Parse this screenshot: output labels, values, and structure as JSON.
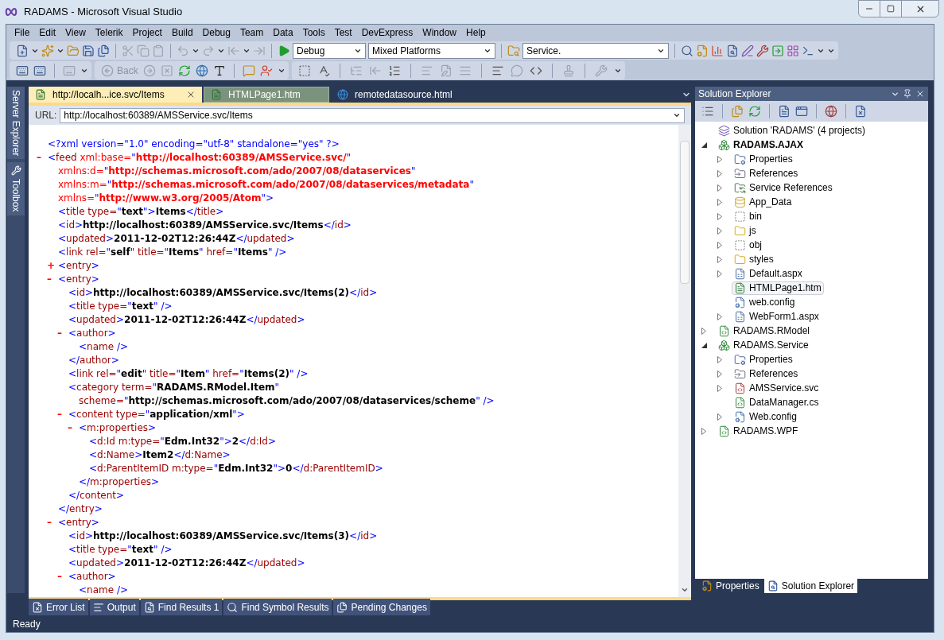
{
  "window": {
    "title": "RADAMS - Microsoft Visual Studio"
  },
  "menu": [
    "File",
    "Edit",
    "View",
    "Telerik",
    "Project",
    "Build",
    "Debug",
    "Team",
    "Data",
    "Tools",
    "Test",
    "DevExpress",
    "Window",
    "Help"
  ],
  "toolbar": {
    "configuration": "Debug",
    "platform": "Mixed Platforms",
    "find": "Service.",
    "back_label": "Back"
  },
  "side_tabs": [
    "Server Explorer",
    "Toolbox"
  ],
  "document": {
    "tabs": [
      {
        "label": "http://localh...ice.svc/Items",
        "selected": true,
        "highlighted": false,
        "kind": "page"
      },
      {
        "label": "HTMLPage1.htm",
        "selected": false,
        "highlighted": true,
        "kind": "page"
      },
      {
        "label": "remotedatasource.html",
        "selected": false,
        "highlighted": false,
        "kind": "browser"
      }
    ],
    "url_label": "URL:",
    "url": "http://localhost:60389/AMSService.svc/Items",
    "xml": [
      {
        "segs": [
          {
            "kind": "punct",
            "text": "<?xml version=\"1.0\" encoding=\"utf-8\" standalone=\"yes\" ?>"
          }
        ]
      },
      {
        "toggle": "–",
        "segs": [
          {
            "kind": "punct",
            "text": "<"
          },
          {
            "kind": "name",
            "text": "feed "
          },
          {
            "kind": "attr",
            "text": "xml:base="
          },
          {
            "kind": "punct",
            "text": "\""
          },
          {
            "kind": "url",
            "text": "http://localhost:60389/AMSService.svc/"
          },
          {
            "kind": "punct",
            "text": "\""
          }
        ],
        "cont": [
          [
            {
              "kind": "attr",
              "text": "xmlns:d="
            },
            {
              "kind": "punct",
              "text": "\""
            },
            {
              "kind": "url",
              "text": "http://schemas.microsoft.com/ado/2007/08/dataservices"
            },
            {
              "kind": "punct",
              "text": "\""
            }
          ],
          [
            {
              "kind": "attr",
              "text": "xmlns:m="
            },
            {
              "kind": "punct",
              "text": "\""
            },
            {
              "kind": "url",
              "text": "http://schemas.microsoft.com/ado/2007/08/dataservices/metadata"
            },
            {
              "kind": "punct",
              "text": "\""
            }
          ],
          [
            {
              "kind": "attr",
              "text": "xmlns="
            },
            {
              "kind": "punct",
              "text": "\""
            },
            {
              "kind": "url",
              "text": "http://www.w3.org/2005/Atom"
            },
            {
              "kind": "punct",
              "text": "\">"
            }
          ]
        ],
        "children": [
          {
            "segs": [
              {
                "kind": "punct",
                "text": "<"
              },
              {
                "kind": "name",
                "text": "title type="
              },
              {
                "kind": "punct",
                "text": "\""
              },
              {
                "kind": "value",
                "text": "text"
              },
              {
                "kind": "punct",
                "text": "\">"
              },
              {
                "kind": "value",
                "text": "Items"
              },
              {
                "kind": "punct",
                "text": "</"
              },
              {
                "kind": "name",
                "text": "title"
              },
              {
                "kind": "punct",
                "text": ">"
              }
            ]
          },
          {
            "segs": [
              {
                "kind": "punct",
                "text": "<"
              },
              {
                "kind": "name",
                "text": "id"
              },
              {
                "kind": "punct",
                "text": ">"
              },
              {
                "kind": "value",
                "text": "http://localhost:60389/AMSService.svc/Items"
              },
              {
                "kind": "punct",
                "text": "</"
              },
              {
                "kind": "name",
                "text": "id"
              },
              {
                "kind": "punct",
                "text": ">"
              }
            ]
          },
          {
            "segs": [
              {
                "kind": "punct",
                "text": "<"
              },
              {
                "kind": "name",
                "text": "updated"
              },
              {
                "kind": "punct",
                "text": ">"
              },
              {
                "kind": "value",
                "text": "2011-12-02T12:26:44Z"
              },
              {
                "kind": "punct",
                "text": "</"
              },
              {
                "kind": "name",
                "text": "updated"
              },
              {
                "kind": "punct",
                "text": ">"
              }
            ]
          },
          {
            "segs": [
              {
                "kind": "punct",
                "text": "<"
              },
              {
                "kind": "name",
                "text": "link rel="
              },
              {
                "kind": "punct",
                "text": "\""
              },
              {
                "kind": "value",
                "text": "self"
              },
              {
                "kind": "punct",
                "text": "\" "
              },
              {
                "kind": "name",
                "text": "title="
              },
              {
                "kind": "punct",
                "text": "\""
              },
              {
                "kind": "value",
                "text": "Items"
              },
              {
                "kind": "punct",
                "text": "\" "
              },
              {
                "kind": "name",
                "text": "href="
              },
              {
                "kind": "punct",
                "text": "\""
              },
              {
                "kind": "value",
                "text": "Items"
              },
              {
                "kind": "punct",
                "text": "\" />"
              }
            ]
          },
          {
            "toggle": "+",
            "segs": [
              {
                "kind": "punct",
                "text": "<"
              },
              {
                "kind": "name",
                "text": "entry"
              },
              {
                "kind": "punct",
                "text": ">"
              }
            ]
          },
          {
            "toggle": "–",
            "segs": [
              {
                "kind": "punct",
                "text": "<"
              },
              {
                "kind": "name",
                "text": "entry"
              },
              {
                "kind": "punct",
                "text": ">"
              }
            ],
            "children": [
              {
                "segs": [
                  {
                    "kind": "punct",
                    "text": "<"
                  },
                  {
                    "kind": "name",
                    "text": "id"
                  },
                  {
                    "kind": "punct",
                    "text": ">"
                  },
                  {
                    "kind": "value",
                    "text": "http://localhost:60389/AMSService.svc/Items(2)"
                  },
                  {
                    "kind": "punct",
                    "text": "</"
                  },
                  {
                    "kind": "name",
                    "text": "id"
                  },
                  {
                    "kind": "punct",
                    "text": ">"
                  }
                ]
              },
              {
                "segs": [
                  {
                    "kind": "punct",
                    "text": "<"
                  },
                  {
                    "kind": "name",
                    "text": "title type="
                  },
                  {
                    "kind": "punct",
                    "text": "\""
                  },
                  {
                    "kind": "value",
                    "text": "text"
                  },
                  {
                    "kind": "punct",
                    "text": "\" />"
                  }
                ]
              },
              {
                "segs": [
                  {
                    "kind": "punct",
                    "text": "<"
                  },
                  {
                    "kind": "name",
                    "text": "updated"
                  },
                  {
                    "kind": "punct",
                    "text": ">"
                  },
                  {
                    "kind": "value",
                    "text": "2011-12-02T12:26:44Z"
                  },
                  {
                    "kind": "punct",
                    "text": "</"
                  },
                  {
                    "kind": "name",
                    "text": "updated"
                  },
                  {
                    "kind": "punct",
                    "text": ">"
                  }
                ]
              },
              {
                "toggle": "–",
                "segs": [
                  {
                    "kind": "punct",
                    "text": "<"
                  },
                  {
                    "kind": "name",
                    "text": "author"
                  },
                  {
                    "kind": "punct",
                    "text": ">"
                  }
                ],
                "children": [
                  {
                    "segs": [
                      {
                        "kind": "punct",
                        "text": "<"
                      },
                      {
                        "kind": "name",
                        "text": "name"
                      },
                      {
                        "kind": "punct",
                        "text": " />"
                      }
                    ]
                  }
                ],
                "close": [
                  {
                    "kind": "punct",
                    "text": "</"
                  },
                  {
                    "kind": "name",
                    "text": "author"
                  },
                  {
                    "kind": "punct",
                    "text": ">"
                  }
                ]
              },
              {
                "segs": [
                  {
                    "kind": "punct",
                    "text": "<"
                  },
                  {
                    "kind": "name",
                    "text": "link rel="
                  },
                  {
                    "kind": "punct",
                    "text": "\""
                  },
                  {
                    "kind": "value",
                    "text": "edit"
                  },
                  {
                    "kind": "punct",
                    "text": "\" "
                  },
                  {
                    "kind": "name",
                    "text": "title="
                  },
                  {
                    "kind": "punct",
                    "text": "\""
                  },
                  {
                    "kind": "value",
                    "text": "Item"
                  },
                  {
                    "kind": "punct",
                    "text": "\" "
                  },
                  {
                    "kind": "name",
                    "text": "href="
                  },
                  {
                    "kind": "punct",
                    "text": "\""
                  },
                  {
                    "kind": "value",
                    "text": "Items(2)"
                  },
                  {
                    "kind": "punct",
                    "text": "\" />"
                  }
                ]
              },
              {
                "segs": [
                  {
                    "kind": "punct",
                    "text": "<"
                  },
                  {
                    "kind": "name",
                    "text": "category term="
                  },
                  {
                    "kind": "punct",
                    "text": "\""
                  },
                  {
                    "kind": "value",
                    "text": "RADAMS.RModel.Item"
                  },
                  {
                    "kind": "punct",
                    "text": "\""
                  }
                ],
                "cont": [
                  [
                    {
                      "kind": "name",
                      "text": "scheme="
                    },
                    {
                      "kind": "punct",
                      "text": "\""
                    },
                    {
                      "kind": "value",
                      "text": "http://schemas.microsoft.com/ado/2007/08/dataservices/scheme"
                    },
                    {
                      "kind": "punct",
                      "text": "\" />"
                    }
                  ]
                ]
              },
              {
                "toggle": "–",
                "segs": [
                  {
                    "kind": "punct",
                    "text": "<"
                  },
                  {
                    "kind": "name",
                    "text": "content type="
                  },
                  {
                    "kind": "punct",
                    "text": "\""
                  },
                  {
                    "kind": "value",
                    "text": "application/xml"
                  },
                  {
                    "kind": "punct",
                    "text": "\">"
                  }
                ],
                "children": [
                  {
                    "toggle": "–",
                    "segs": [
                      {
                        "kind": "punct",
                        "text": "<"
                      },
                      {
                        "kind": "name",
                        "text": "m:properties"
                      },
                      {
                        "kind": "punct",
                        "text": ">"
                      }
                    ],
                    "children": [
                      {
                        "segs": [
                          {
                            "kind": "punct",
                            "text": "<"
                          },
                          {
                            "kind": "name",
                            "text": "d:Id m:type="
                          },
                          {
                            "kind": "punct",
                            "text": "\""
                          },
                          {
                            "kind": "value",
                            "text": "Edm.Int32"
                          },
                          {
                            "kind": "punct",
                            "text": "\">"
                          },
                          {
                            "kind": "value",
                            "text": "2"
                          },
                          {
                            "kind": "punct",
                            "text": "</"
                          },
                          {
                            "kind": "name",
                            "text": "d:Id"
                          },
                          {
                            "kind": "punct",
                            "text": ">"
                          }
                        ]
                      },
                      {
                        "segs": [
                          {
                            "kind": "punct",
                            "text": "<"
                          },
                          {
                            "kind": "name",
                            "text": "d:Name"
                          },
                          {
                            "kind": "punct",
                            "text": ">"
                          },
                          {
                            "kind": "value",
                            "text": "Item2"
                          },
                          {
                            "kind": "punct",
                            "text": "</"
                          },
                          {
                            "kind": "name",
                            "text": "d:Name"
                          },
                          {
                            "kind": "punct",
                            "text": ">"
                          }
                        ]
                      },
                      {
                        "segs": [
                          {
                            "kind": "punct",
                            "text": "<"
                          },
                          {
                            "kind": "name",
                            "text": "d:ParentItemID m:type="
                          },
                          {
                            "kind": "punct",
                            "text": "\""
                          },
                          {
                            "kind": "value",
                            "text": "Edm.Int32"
                          },
                          {
                            "kind": "punct",
                            "text": "\">"
                          },
                          {
                            "kind": "value",
                            "text": "0"
                          },
                          {
                            "kind": "punct",
                            "text": "</"
                          },
                          {
                            "kind": "name",
                            "text": "d:ParentItemID"
                          },
                          {
                            "kind": "punct",
                            "text": ">"
                          }
                        ]
                      }
                    ],
                    "close": [
                      {
                        "kind": "punct",
                        "text": "</"
                      },
                      {
                        "kind": "name",
                        "text": "m:properties"
                      },
                      {
                        "kind": "punct",
                        "text": ">"
                      }
                    ]
                  }
                ],
                "close": [
                  {
                    "kind": "punct",
                    "text": "</"
                  },
                  {
                    "kind": "name",
                    "text": "content"
                  },
                  {
                    "kind": "punct",
                    "text": ">"
                  }
                ]
              }
            ],
            "close": [
              {
                "kind": "punct",
                "text": "</"
              },
              {
                "kind": "name",
                "text": "entry"
              },
              {
                "kind": "punct",
                "text": ">"
              }
            ]
          },
          {
            "toggle": "–",
            "segs": [
              {
                "kind": "punct",
                "text": "<"
              },
              {
                "kind": "name",
                "text": "entry"
              },
              {
                "kind": "punct",
                "text": ">"
              }
            ],
            "children": [
              {
                "segs": [
                  {
                    "kind": "punct",
                    "text": "<"
                  },
                  {
                    "kind": "name",
                    "text": "id"
                  },
                  {
                    "kind": "punct",
                    "text": ">"
                  },
                  {
                    "kind": "value",
                    "text": "http://localhost:60389/AMSService.svc/Items(3)"
                  },
                  {
                    "kind": "punct",
                    "text": "</"
                  },
                  {
                    "kind": "name",
                    "text": "id"
                  },
                  {
                    "kind": "punct",
                    "text": ">"
                  }
                ]
              },
              {
                "segs": [
                  {
                    "kind": "punct",
                    "text": "<"
                  },
                  {
                    "kind": "name",
                    "text": "title type="
                  },
                  {
                    "kind": "punct",
                    "text": "\""
                  },
                  {
                    "kind": "value",
                    "text": "text"
                  },
                  {
                    "kind": "punct",
                    "text": "\" />"
                  }
                ]
              },
              {
                "segs": [
                  {
                    "kind": "punct",
                    "text": "<"
                  },
                  {
                    "kind": "name",
                    "text": "updated"
                  },
                  {
                    "kind": "punct",
                    "text": ">"
                  },
                  {
                    "kind": "value",
                    "text": "2011-12-02T12:26:44Z"
                  },
                  {
                    "kind": "punct",
                    "text": "</"
                  },
                  {
                    "kind": "name",
                    "text": "updated"
                  },
                  {
                    "kind": "punct",
                    "text": ">"
                  }
                ]
              },
              {
                "toggle": "–",
                "segs": [
                  {
                    "kind": "punct",
                    "text": "<"
                  },
                  {
                    "kind": "name",
                    "text": "author"
                  },
                  {
                    "kind": "punct",
                    "text": ">"
                  }
                ],
                "children": [
                  {
                    "segs": [
                      {
                        "kind": "punct",
                        "text": "<"
                      },
                      {
                        "kind": "name",
                        "text": "name"
                      },
                      {
                        "kind": "punct",
                        "text": " />"
                      }
                    ]
                  }
                ]
              }
            ]
          }
        ]
      }
    ]
  },
  "solution_explorer": {
    "title": "Solution Explorer",
    "tree": [
      {
        "label": "Solution 'RADAMS' (4 projects)",
        "kind": "solution",
        "selected": false,
        "children": [
          {
            "label": "RADAMS.AJAX",
            "kind": "web-project",
            "startup": true,
            "expanded": true,
            "selected": false,
            "children": [
              {
                "label": "Properties",
                "kind": "properties",
                "expanded": false,
                "selected": false
              },
              {
                "label": "References",
                "kind": "references",
                "expanded": false,
                "selected": false
              },
              {
                "label": "Service References",
                "kind": "service-references",
                "expanded": false,
                "selected": false
              },
              {
                "label": "App_Data",
                "kind": "data-folder",
                "expanded": false,
                "selected": false
              },
              {
                "label": "bin",
                "kind": "hidden-folder",
                "expanded": false,
                "selected": false
              },
              {
                "label": "js",
                "kind": "folder",
                "expanded": false,
                "selected": false
              },
              {
                "label": "obj",
                "kind": "hidden-folder",
                "expanded": false,
                "selected": false
              },
              {
                "label": "styles",
                "kind": "folder",
                "expanded": false,
                "selected": false
              },
              {
                "label": "Default.aspx",
                "kind": "form",
                "expanded": false,
                "selected": false
              },
              {
                "label": "HTMLPage1.htm",
                "kind": "page",
                "selected": true
              },
              {
                "label": "web.config",
                "kind": "config",
                "selected": false
              },
              {
                "label": "WebForm1.aspx",
                "kind": "form",
                "expanded": false,
                "selected": false
              }
            ]
          },
          {
            "label": "RADAMS.RModel",
            "kind": "cs-project",
            "startup": false,
            "expanded": false,
            "selected": false
          },
          {
            "label": "RADAMS.Service",
            "kind": "web-project",
            "startup": false,
            "expanded": true,
            "selected": false,
            "children": [
              {
                "label": "Properties",
                "kind": "properties",
                "expanded": false,
                "selected": false
              },
              {
                "label": "References",
                "kind": "references",
                "expanded": false,
                "selected": false
              },
              {
                "label": "AMSService.svc",
                "kind": "service",
                "expanded": false,
                "selected": false
              },
              {
                "label": "DataManager.cs",
                "kind": "cs-file",
                "selected": false
              },
              {
                "label": "Web.config",
                "kind": "config",
                "expanded": false,
                "selected": false
              }
            ]
          },
          {
            "label": "RADAMS.WPF",
            "kind": "cs-project",
            "startup": false,
            "expanded": false,
            "selected": false
          }
        ]
      }
    ],
    "bottom_tabs": [
      {
        "label": "Properties",
        "selected": false
      },
      {
        "label": "Solution Explorer",
        "selected": true
      }
    ]
  },
  "tool_tabs": [
    "Error List",
    "Output",
    "Find Results 1",
    "Find Symbol Results",
    "Pending Changes"
  ],
  "status_bar": "Ready"
}
